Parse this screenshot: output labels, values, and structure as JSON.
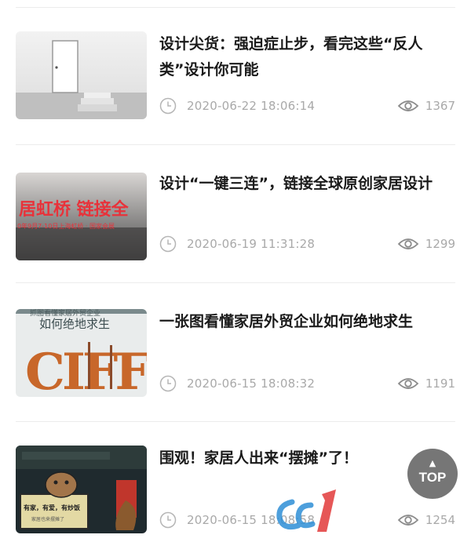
{
  "articles": [
    {
      "title": "设计尖货：强迫症止步，看完这些“反人类”设计你可能",
      "date": "2020-06-22 18:06:14",
      "views": "1367",
      "thumb_icon": "door-room-photo"
    },
    {
      "title": "设计“一键三连”，链接全球原创家居设计",
      "date": "2020-06-19 11:31:28",
      "views": "1299",
      "thumb_icon": "banner-photo",
      "thumb_text": "居虹桥 链接全",
      "thumb_subtext": "0年9月7-10日上海虹桥 · 国家会展"
    },
    {
      "title": "一张图看懂家居外贸企业如何绝地求生",
      "date": "2020-06-15 18:08:32",
      "views": "1191",
      "thumb_icon": "ciff-poster",
      "thumb_text": "如何绝地求生",
      "thumb_top": "抓图看懂家居外贸企业",
      "thumb_logo": "CIFF"
    },
    {
      "title": "围观！家居人出来“摆摊”了！",
      "date": "2020-06-15 18:08:58",
      "views": "1254",
      "thumb_icon": "cartoon-stall",
      "thumb_text": "有家，有爱，有炒饭",
      "thumb_sub": "家居也来摆摊了"
    }
  ],
  "top_button": {
    "label": "TOP",
    "arrow": "▲"
  }
}
